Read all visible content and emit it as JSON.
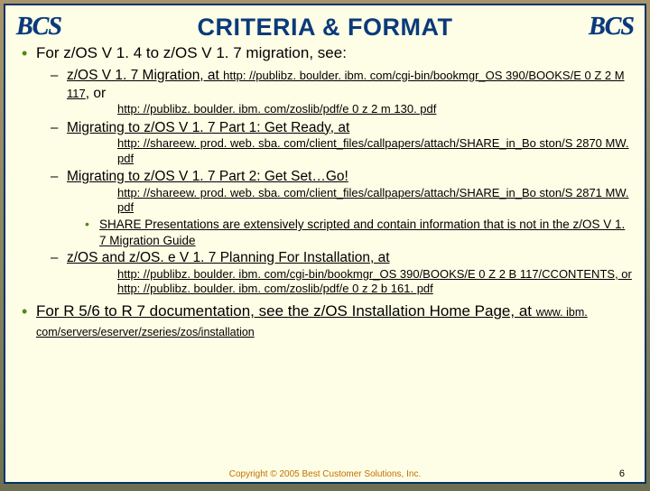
{
  "logo": "BCS",
  "title": "CRITERIA & FORMAT",
  "b1_a": "For z/OS V 1. 4 to z/OS V 1. 7 migration, see:",
  "b2_1_lead": " z/OS V 1. 7 Migration, at ",
  "b2_1_url1": "http: //publibz. boulder. ibm. com/cgi-bin/bookmgr_OS 390/BOOKS/E 0 Z 2 M 117",
  "b2_1_mid": ", or ",
  "b2_1_url2": "http: //publibz. boulder. ibm. com/zoslib/pdf/e 0 z 2 m 130. pdf",
  "b2_2_lead": "Migrating to z/OS V 1. 7 Part 1: Get Ready, at",
  "b2_2_url": "http: //shareew. prod. web. sba. com/client_files/callpapers/attach/SHARE_in_Bo ston/S 2870 MW. pdf",
  "b2_3_lead": "Migrating to z/OS V 1. 7 Part 2: Get Set…Go!",
  "b2_3_url": "http: //shareew. prod. web. sba. com/client_files/callpapers/attach/SHARE_in_Bo ston/S 2871 MW. pdf",
  "b3_1": "SHARE Presentations are extensively scripted and contain information that is not in the z/OS V 1. 7 Migration Guide",
  "b2_4_lead": "z/OS and z/OS. e V 1. 7 Planning For Installation, at",
  "b2_4_url1": "http: //publibz. boulder. ibm. com/cgi-bin/bookmgr_OS 390/BOOKS/E 0 Z 2 B 117/CCONTENTS",
  "b2_4_mid": ", or ",
  "b2_4_url2": "http: //publibz. boulder. ibm. com/zoslib/pdf/e 0 z 2 b 161. pdf",
  "b1_b_lead": "For R 5/6 to R 7 documentation, see the z/OS Installation Home Page, at ",
  "b1_b_url": "www. ibm. com/servers/eserver/zseries/zos/installation",
  "copyright": "Copyright © 2005 Best Customer Solutions, Inc.",
  "pagenum": "6"
}
